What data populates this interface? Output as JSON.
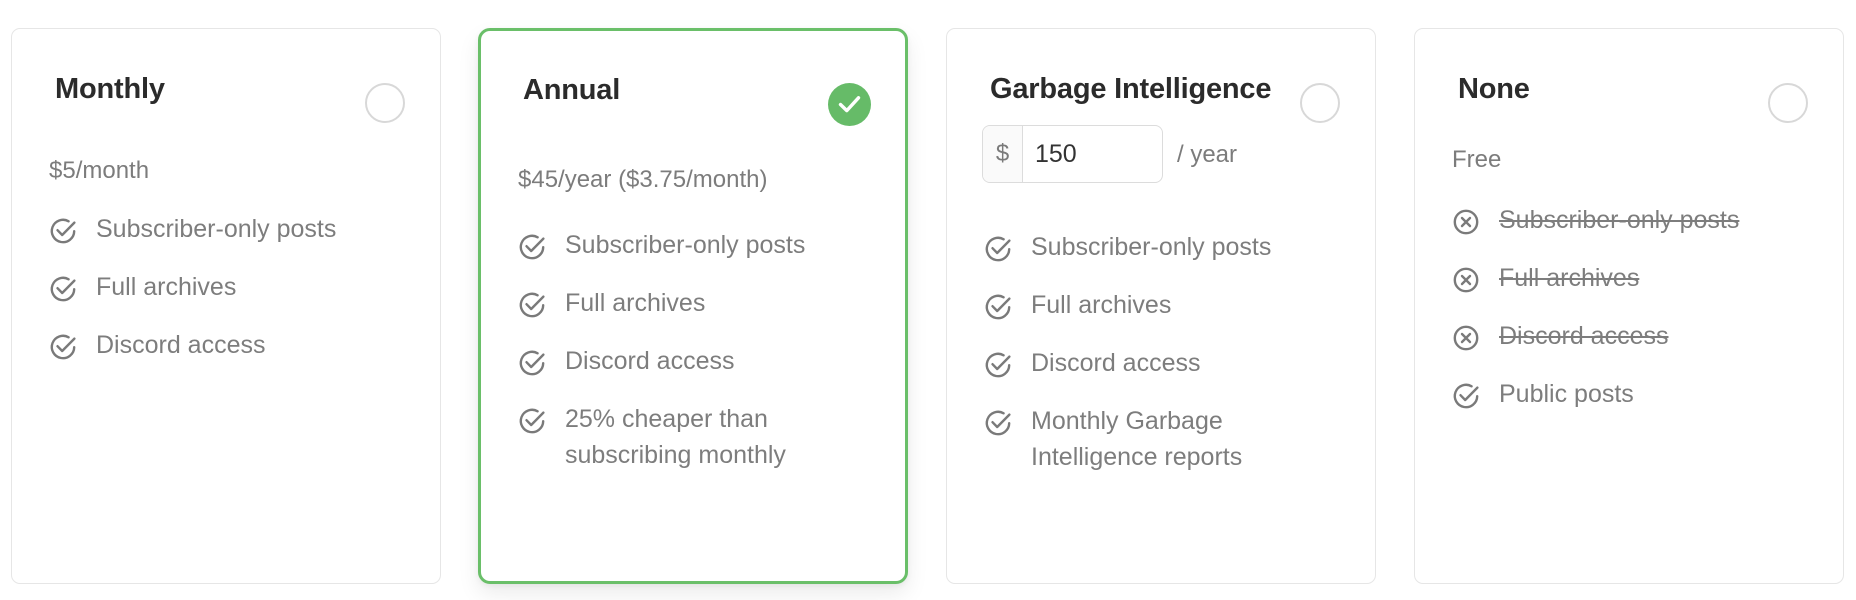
{
  "plans": [
    {
      "title": "Monthly",
      "price": "$5/month",
      "selected": false,
      "features": [
        {
          "label": "Subscriber-only posts",
          "included": true,
          "icon": "check-circle-icon"
        },
        {
          "label": "Full archives",
          "included": true,
          "icon": "check-circle-icon"
        },
        {
          "label": "Discord access",
          "included": true,
          "icon": "check-circle-icon"
        }
      ]
    },
    {
      "title": "Annual",
      "price": "$45/year ($3.75/month)",
      "selected": true,
      "features": [
        {
          "label": "Subscriber-only posts",
          "included": true,
          "icon": "check-circle-icon"
        },
        {
          "label": "Full archives",
          "included": true,
          "icon": "check-circle-icon"
        },
        {
          "label": "Discord access",
          "included": true,
          "icon": "check-circle-icon"
        },
        {
          "label": "25% cheaper than subscribing monthly",
          "included": true,
          "icon": "check-circle-icon"
        }
      ]
    },
    {
      "title": "Garbage Intelligence",
      "currency_symbol": "$",
      "amount_value": "150",
      "period": "/ year",
      "selected": false,
      "features": [
        {
          "label": "Subscriber-only posts",
          "included": true,
          "icon": "check-circle-icon"
        },
        {
          "label": "Full archives",
          "included": true,
          "icon": "check-circle-icon"
        },
        {
          "label": "Discord access",
          "included": true,
          "icon": "check-circle-icon"
        },
        {
          "label": "Monthly Garbage Intelligence reports",
          "included": true,
          "icon": "check-circle-icon"
        }
      ]
    },
    {
      "title": "None",
      "price": "Free",
      "selected": false,
      "features": [
        {
          "label": "Subscriber-only posts",
          "included": false,
          "icon": "x-circle-icon"
        },
        {
          "label": "Full archives",
          "included": false,
          "icon": "x-circle-icon"
        },
        {
          "label": "Discord access",
          "included": false,
          "icon": "x-circle-icon"
        },
        {
          "label": "Public posts",
          "included": true,
          "icon": "check-circle-icon"
        }
      ]
    }
  ],
  "colors": {
    "accent_green": "#66bb68",
    "selected_border": "#6abf69",
    "title_text": "#2b2b2b",
    "muted_text": "#7d7d7d",
    "card_border": "#e6e6e6"
  }
}
